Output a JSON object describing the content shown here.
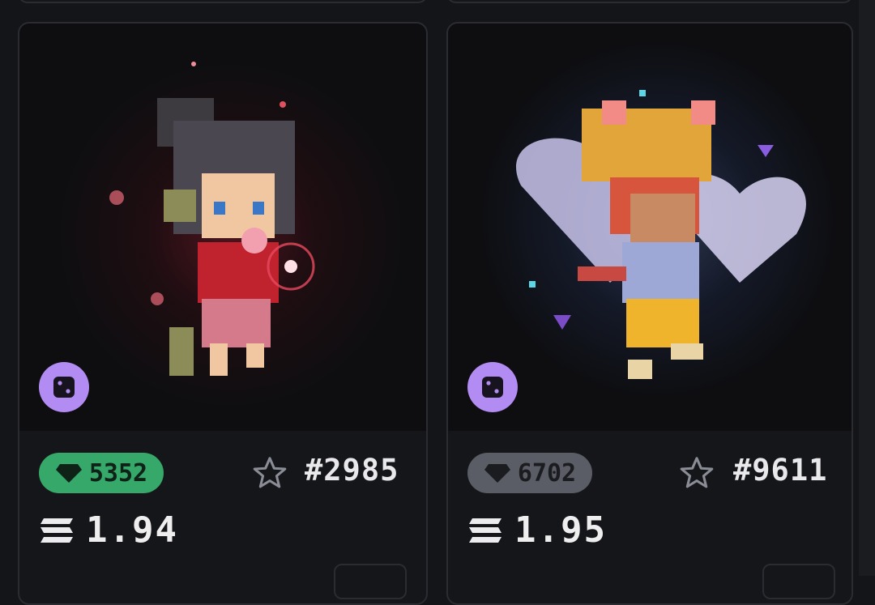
{
  "cards": [
    {
      "gems": "5352",
      "gem_color": "#36a86a",
      "item_number": "#2985",
      "price": "1.94",
      "art_icon": "pixel-avatar-red-art",
      "badge_icon": "dice-icon"
    },
    {
      "gems": "6702",
      "gem_color": "#5a5d66",
      "item_number": "#9611",
      "price": "1.95",
      "art_icon": "pixel-avatar-blue-art",
      "badge_icon": "dice-icon"
    }
  ],
  "colors": {
    "accent_purple": "#b28cf2",
    "background": "#141518"
  }
}
